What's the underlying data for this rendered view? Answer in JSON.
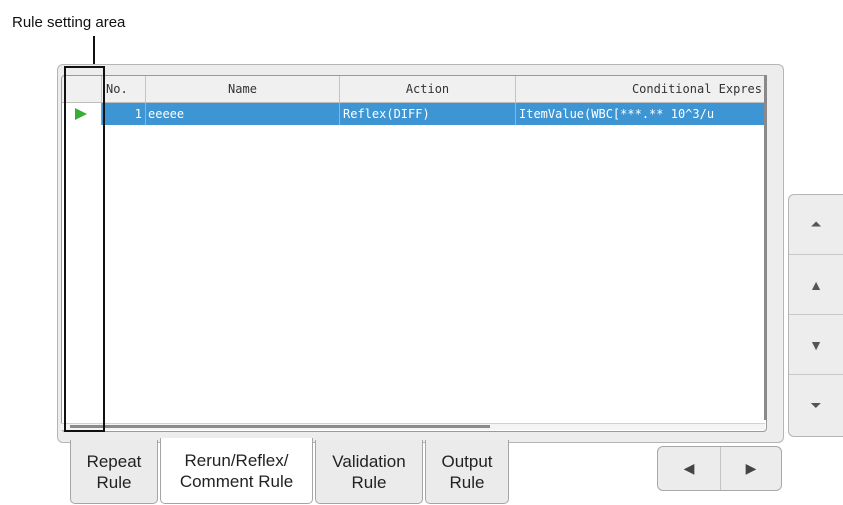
{
  "callout": {
    "label": "Rule setting area"
  },
  "table": {
    "columns": [
      "",
      "No.",
      "Name",
      "Action",
      "Conditional Expres"
    ],
    "rows": [
      {
        "selected": true,
        "no": "1",
        "name": "eeeee",
        "action": "Reflex(DIFF)",
        "condition": "ItemValue(WBC[***.** 10^3/u"
      }
    ]
  },
  "side_buttons": [
    {
      "icon": "double-up-arrow-icon",
      "glyph": "⏶"
    },
    {
      "icon": "up-arrow-icon",
      "glyph": "▲"
    },
    {
      "icon": "down-arrow-icon",
      "glyph": "▼"
    },
    {
      "icon": "double-down-arrow-icon",
      "glyph": "⏷"
    }
  ],
  "tabs": [
    {
      "label": "Repeat\nRule",
      "active": false
    },
    {
      "label": "Rerun/Reflex/\nComment Rule",
      "active": true
    },
    {
      "label": "Validation\nRule",
      "active": false
    },
    {
      "label": "Output\nRule",
      "active": false
    }
  ],
  "nav": {
    "prev_glyph": "◀",
    "next_glyph": "▶"
  },
  "colors": {
    "selection": "#3d95d4",
    "play_marker": "#35b035"
  }
}
